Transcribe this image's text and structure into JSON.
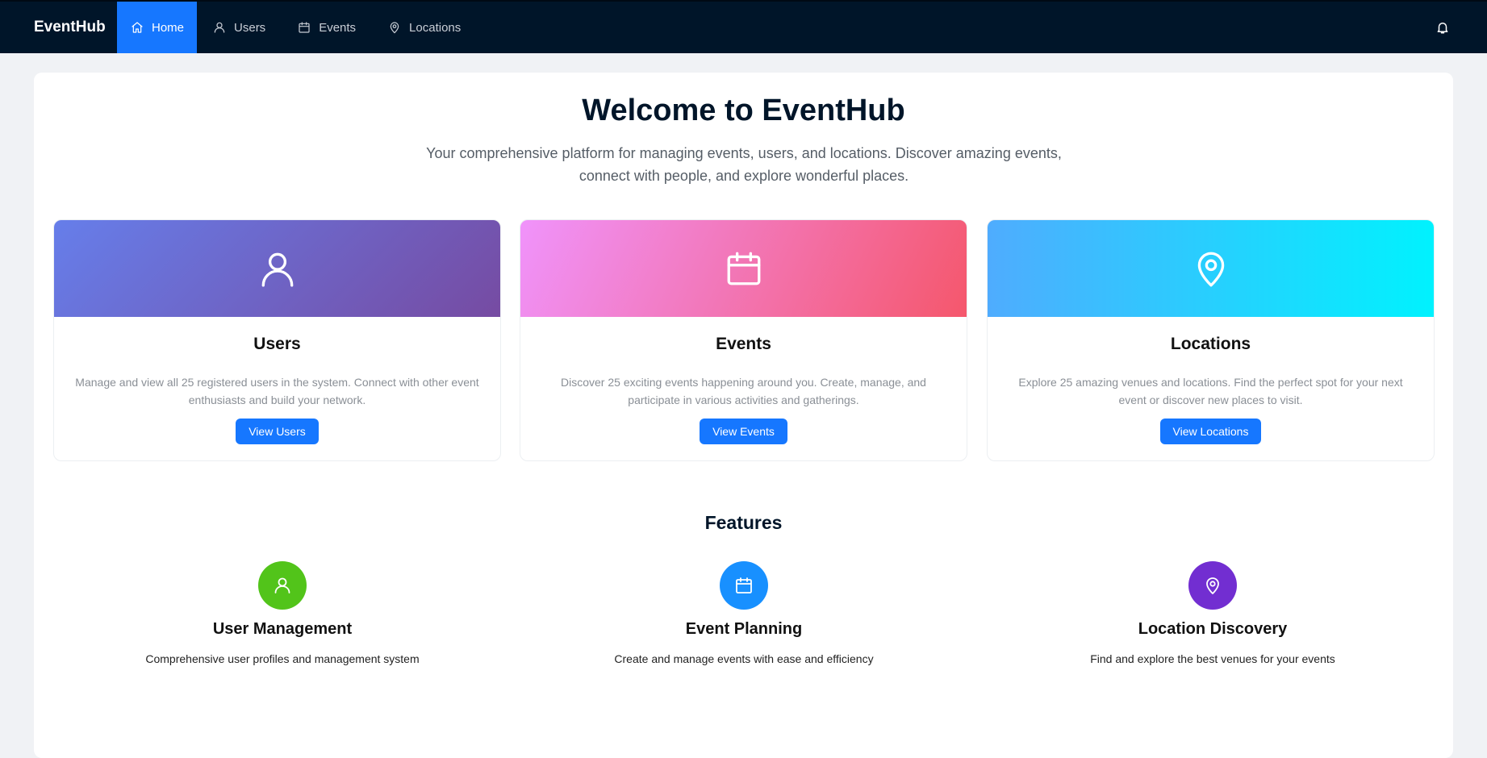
{
  "nav": {
    "brand": "EventHub",
    "items": [
      {
        "label": "Home",
        "icon": "home-icon",
        "active": true
      },
      {
        "label": "Users",
        "icon": "user-icon",
        "active": false
      },
      {
        "label": "Events",
        "icon": "calendar-icon",
        "active": false
      },
      {
        "label": "Locations",
        "icon": "map-pin-icon",
        "active": false
      }
    ],
    "notification_icon": "bell-icon"
  },
  "hero": {
    "title": "Welcome to EventHub",
    "subtitle": "Your comprehensive platform for managing events, users, and locations. Discover amazing events, connect with people, and explore wonderful places."
  },
  "cards": [
    {
      "title": "Users",
      "icon": "user-icon",
      "description": "Manage and view all 25 registered users in the system. Connect with other event enthusiasts and build your network.",
      "button": "View Users",
      "gradient": [
        "#667eea",
        "#764ba2"
      ]
    },
    {
      "title": "Events",
      "icon": "calendar-icon",
      "description": "Discover 25 exciting events happening around you. Create, manage, and participate in various activities and gatherings.",
      "button": "View Events",
      "gradient": [
        "#f093fb",
        "#f5576c"
      ]
    },
    {
      "title": "Locations",
      "icon": "map-pin-icon",
      "description": "Explore 25 amazing venues and locations. Find the perfect spot for your next event or discover new places to visit.",
      "button": "View Locations",
      "gradient": [
        "#4facfe",
        "#00f2fe"
      ]
    }
  ],
  "features": {
    "title": "Features",
    "items": [
      {
        "title": "User Management",
        "description": "Comprehensive user profiles and management system",
        "icon": "user-icon",
        "color": "#52c41a"
      },
      {
        "title": "Event Planning",
        "description": "Create and manage events with ease and efficiency",
        "icon": "calendar-icon",
        "color": "#1890ff"
      },
      {
        "title": "Location Discovery",
        "description": "Find and explore the best venues for your events",
        "icon": "map-pin-icon",
        "color": "#722ed1"
      }
    ]
  },
  "colors": {
    "nav_bg": "#001529",
    "accent": "#1677ff",
    "page_bg": "#f0f2f5"
  }
}
